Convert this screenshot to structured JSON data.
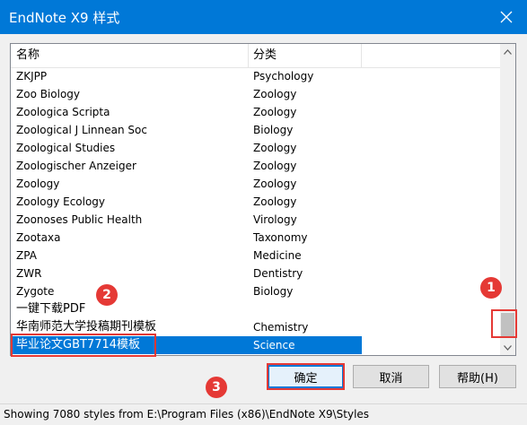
{
  "window": {
    "title": "EndNote X9 样式"
  },
  "list": {
    "columns": {
      "name": "名称",
      "category": "分类"
    },
    "rows": [
      {
        "name": "ZKJPP",
        "category": "Psychology"
      },
      {
        "name": "Zoo Biology",
        "category": "Zoology"
      },
      {
        "name": "Zoologica Scripta",
        "category": "Zoology"
      },
      {
        "name": "Zoological J Linnean Soc",
        "category": "Biology"
      },
      {
        "name": "Zoological Studies",
        "category": "Zoology"
      },
      {
        "name": "Zoologischer Anzeiger",
        "category": "Zoology"
      },
      {
        "name": "Zoology",
        "category": "Zoology"
      },
      {
        "name": "Zoology Ecology",
        "category": "Zoology"
      },
      {
        "name": "Zoonoses Public Health",
        "category": "Virology"
      },
      {
        "name": "Zootaxa",
        "category": "Taxonomy"
      },
      {
        "name": "ZPA",
        "category": "Medicine"
      },
      {
        "name": "ZWR",
        "category": "Dentistry"
      },
      {
        "name": "Zygote",
        "category": "Biology"
      },
      {
        "name": "一键下载PDF",
        "category": ""
      },
      {
        "name": "华南师范大学投稿期刊模板",
        "category": "Chemistry"
      },
      {
        "name": "毕业论文GBT7714模板",
        "category": "Science"
      }
    ],
    "selected_index": 15
  },
  "buttons": {
    "ok": "确定",
    "cancel": "取消",
    "help": "帮助(H)"
  },
  "status": "Showing 7080 styles from E:\\Program Files (x86)\\EndNote X9\\Styles",
  "annotations": [
    "1",
    "2",
    "3"
  ],
  "colors": {
    "titlebar": "#0078d7",
    "selection": "#0078d7",
    "annotation": "#e53935"
  }
}
